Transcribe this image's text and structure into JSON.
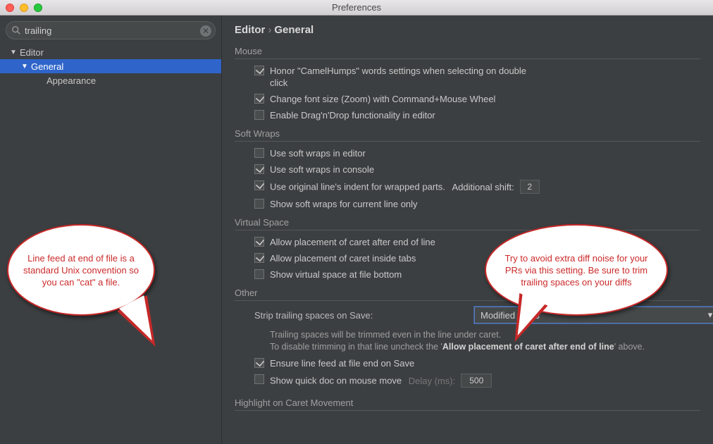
{
  "window_title": "Preferences",
  "search": {
    "value": "trailing"
  },
  "tree": {
    "root": "Editor",
    "selected": "General",
    "child": "Appearance"
  },
  "breadcrumb": {
    "a": "Editor",
    "b": "General"
  },
  "mouse": {
    "label": "Mouse",
    "opt1": "Honor \"CamelHumps\" words settings when selecting on double click",
    "opt2": "Change font size (Zoom) with Command+Mouse Wheel",
    "opt3": "Enable Drag'n'Drop functionality in editor",
    "c1": true,
    "c2": true,
    "c3": false
  },
  "softwraps": {
    "label": "Soft Wraps",
    "opt1": "Use soft wraps in editor",
    "opt2": "Use soft wraps in console",
    "opt3": "Use original line's indent for wrapped parts.",
    "opt3_extra_label": "Additional shift:",
    "opt3_extra_value": "2",
    "opt4": "Show soft wraps for current line only",
    "c1": false,
    "c2": true,
    "c3": true,
    "c4": false
  },
  "virtual": {
    "label": "Virtual Space",
    "opt1": "Allow placement of caret after end of line",
    "opt2": "Allow placement of caret inside tabs",
    "opt3": "Show virtual space at file bottom",
    "c1": true,
    "c2": true,
    "c3": false
  },
  "other": {
    "label": "Other",
    "strip_label": "Strip trailing spaces on Save:",
    "strip_value": "Modified Lines",
    "hint1": "Trailing spaces will be trimmed even in the line under caret.",
    "hint2a": "To disable trimming in that line uncheck the '",
    "hint2b": "Allow placement of caret after end of line",
    "hint2c": "' above.",
    "ensure_lf": "Ensure line feed at file end on Save",
    "ensure_lf_checked": true,
    "quickdoc": "Show quick doc on mouse move",
    "quickdoc_checked": false,
    "delay_label": "Delay (ms):",
    "delay_value": "500"
  },
  "highlight": {
    "label": "Highlight on Caret Movement"
  },
  "callouts": {
    "left": "Line feed at end of file is a standard Unix convention so you can \"cat\" a file.",
    "right": "Try to avoid extra diff noise for your PRs via this setting. Be sure to trim trailing spaces on your diffs"
  }
}
